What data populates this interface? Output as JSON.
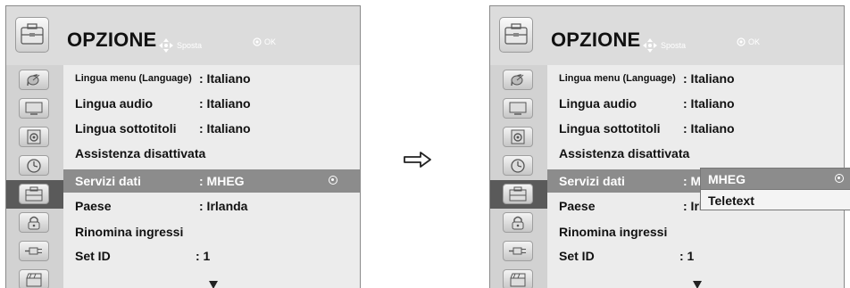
{
  "title": "OPZIONE",
  "hints": {
    "move": "Sposta",
    "ok": "OK"
  },
  "menu": [
    {
      "label": "Lingua menu (Language)",
      "value": ": Italiano"
    },
    {
      "label": "Lingua audio",
      "value": ": Italiano"
    },
    {
      "label": "Lingua sottotitoli",
      "value": ": Italiano"
    },
    {
      "label": "Assistenza disattivata",
      "value": ""
    },
    {
      "label": "Servizi dati",
      "value": ": MHEG"
    },
    {
      "label": "Paese",
      "value": ": Irlanda"
    },
    {
      "label": "Rinomina ingressi",
      "value": ""
    },
    {
      "label": "Set ID",
      "value": ": 1"
    }
  ],
  "selected_item": "Servizi dati",
  "popup": {
    "options": [
      "MHEG",
      "Teletext"
    ],
    "selected": "MHEG"
  },
  "sidebar_icons": [
    "satellite-dish-icon",
    "screen-icon",
    "speaker-icon",
    "clock-icon",
    "option-icon",
    "lock-icon",
    "input-plug-icon",
    "clapper-icon"
  ],
  "colors": {
    "selected_row": "#8c8c8c",
    "active_icon_bg": "#5a5a5a"
  }
}
